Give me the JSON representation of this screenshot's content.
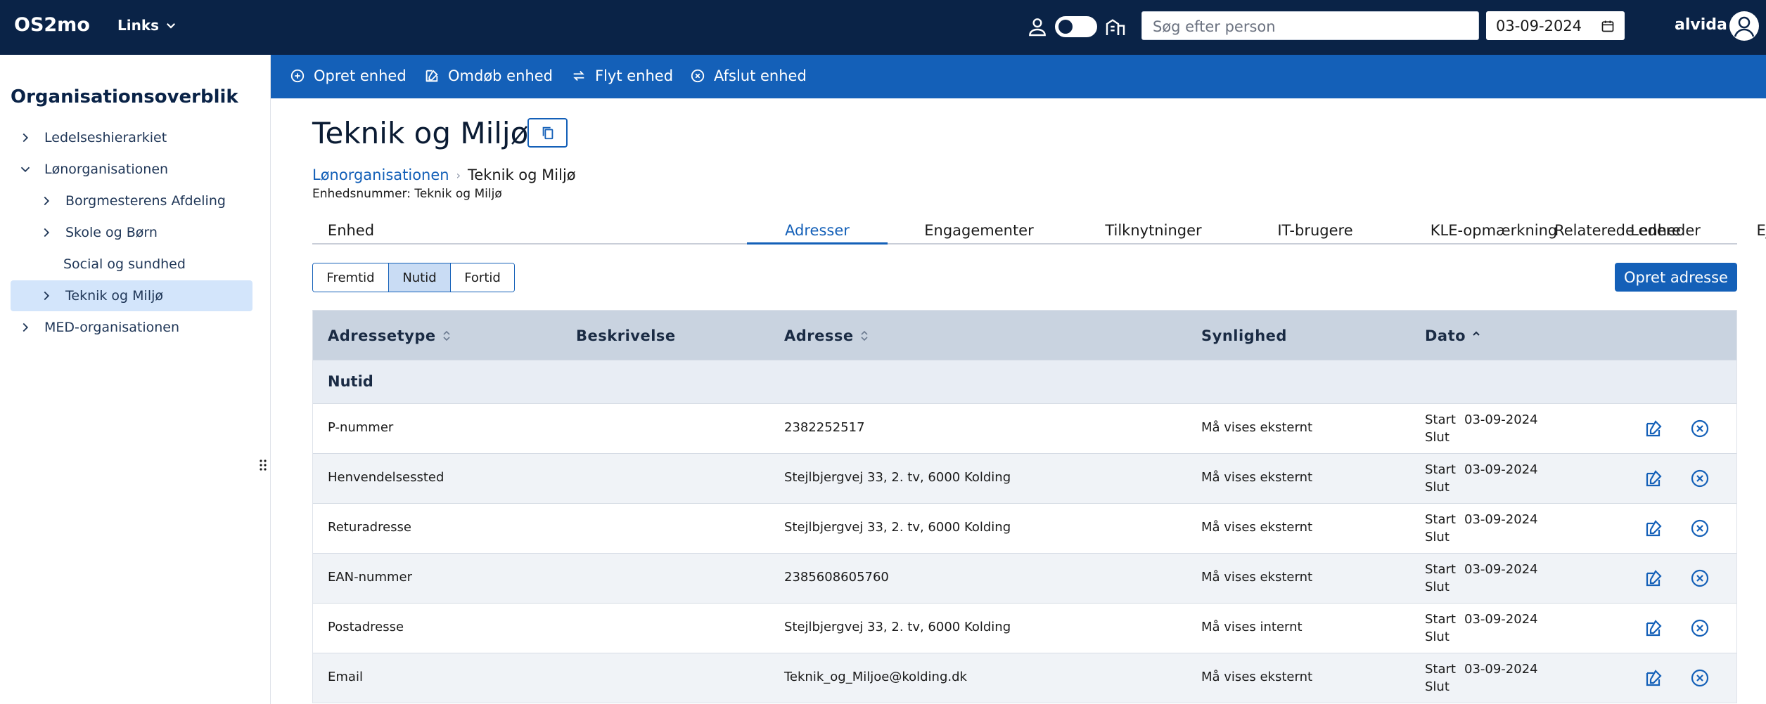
{
  "app": {
    "brand": "OS2mo",
    "links_label": "Links"
  },
  "topbar": {
    "search_placeholder": "Søg efter person",
    "date_value": "03-09-2024",
    "user": "alvida"
  },
  "sidebar": {
    "title": "Organisationsoverblik",
    "items": [
      {
        "label": "Ledelseshierarkiet"
      },
      {
        "label": "Lønorganisationen"
      },
      {
        "label": "Borgmesterens Afdeling"
      },
      {
        "label": "Skole og Børn"
      },
      {
        "label": "Social og sundhed"
      },
      {
        "label": "Teknik og Miljø"
      },
      {
        "label": "MED-organisationen"
      }
    ]
  },
  "actions": {
    "create": "Opret enhed",
    "rename": "Omdøb enhed",
    "move": "Flyt enhed",
    "terminate": "Afslut enhed"
  },
  "page": {
    "title": "Teknik og Miljø",
    "breadcrumb": {
      "parent": "Lønorganisationen",
      "current": "Teknik og Miljø"
    },
    "unit_number": "Enhedsnummer: Teknik og Miljø"
  },
  "tabs": [
    {
      "label": "Enhed"
    },
    {
      "label": "Adresser"
    },
    {
      "label": "Engagementer"
    },
    {
      "label": "Tilknytninger"
    },
    {
      "label": "IT-brugere"
    },
    {
      "label": "KLE-opmærkning"
    },
    {
      "label": "Ledere"
    },
    {
      "label": "Ejere"
    },
    {
      "label": "Relaterede enheder"
    }
  ],
  "filter": {
    "future": "Fremtid",
    "present": "Nutid",
    "past": "Fortid",
    "selected": "Nutid"
  },
  "create_address_button": "Opret adresse",
  "table": {
    "headers": {
      "type": "Adressetype",
      "description": "Beskrivelse",
      "address": "Adresse",
      "visibility": "Synlighed",
      "date": "Dato"
    },
    "group_label": "Nutid",
    "start_label": "Start",
    "end_label": "Slut",
    "rows": [
      {
        "type": "P-nummer",
        "description": "",
        "address": "2382252517",
        "visibility": "Må vises eksternt",
        "start": "03-09-2024",
        "end": ""
      },
      {
        "type": "Henvendelsessted",
        "description": "",
        "address": "Stejlbjergvej 33, 2. tv, 6000 Kolding",
        "visibility": "Må vises eksternt",
        "start": "03-09-2024",
        "end": ""
      },
      {
        "type": "Returadresse",
        "description": "",
        "address": "Stejlbjergvej 33, 2. tv, 6000 Kolding",
        "visibility": "Må vises eksternt",
        "start": "03-09-2024",
        "end": ""
      },
      {
        "type": "EAN-nummer",
        "description": "",
        "address": "2385608605760",
        "visibility": "Må vises eksternt",
        "start": "03-09-2024",
        "end": ""
      },
      {
        "type": "Postadresse",
        "description": "",
        "address": "Stejlbjergvej 33, 2. tv, 6000 Kolding",
        "visibility": "Må vises internt",
        "start": "03-09-2024",
        "end": ""
      },
      {
        "type": "Email",
        "description": "",
        "address": "Teknik_og_Miljoe@kolding.dk",
        "visibility": "Må vises eksternt",
        "start": "03-09-2024",
        "end": ""
      }
    ]
  },
  "colors": {
    "topbar": "#0a2347",
    "actionbar": "#1460b8",
    "accent": "#1460b8",
    "selected_bg": "#d3e5fb",
    "table_header": "#c9d3e0"
  }
}
